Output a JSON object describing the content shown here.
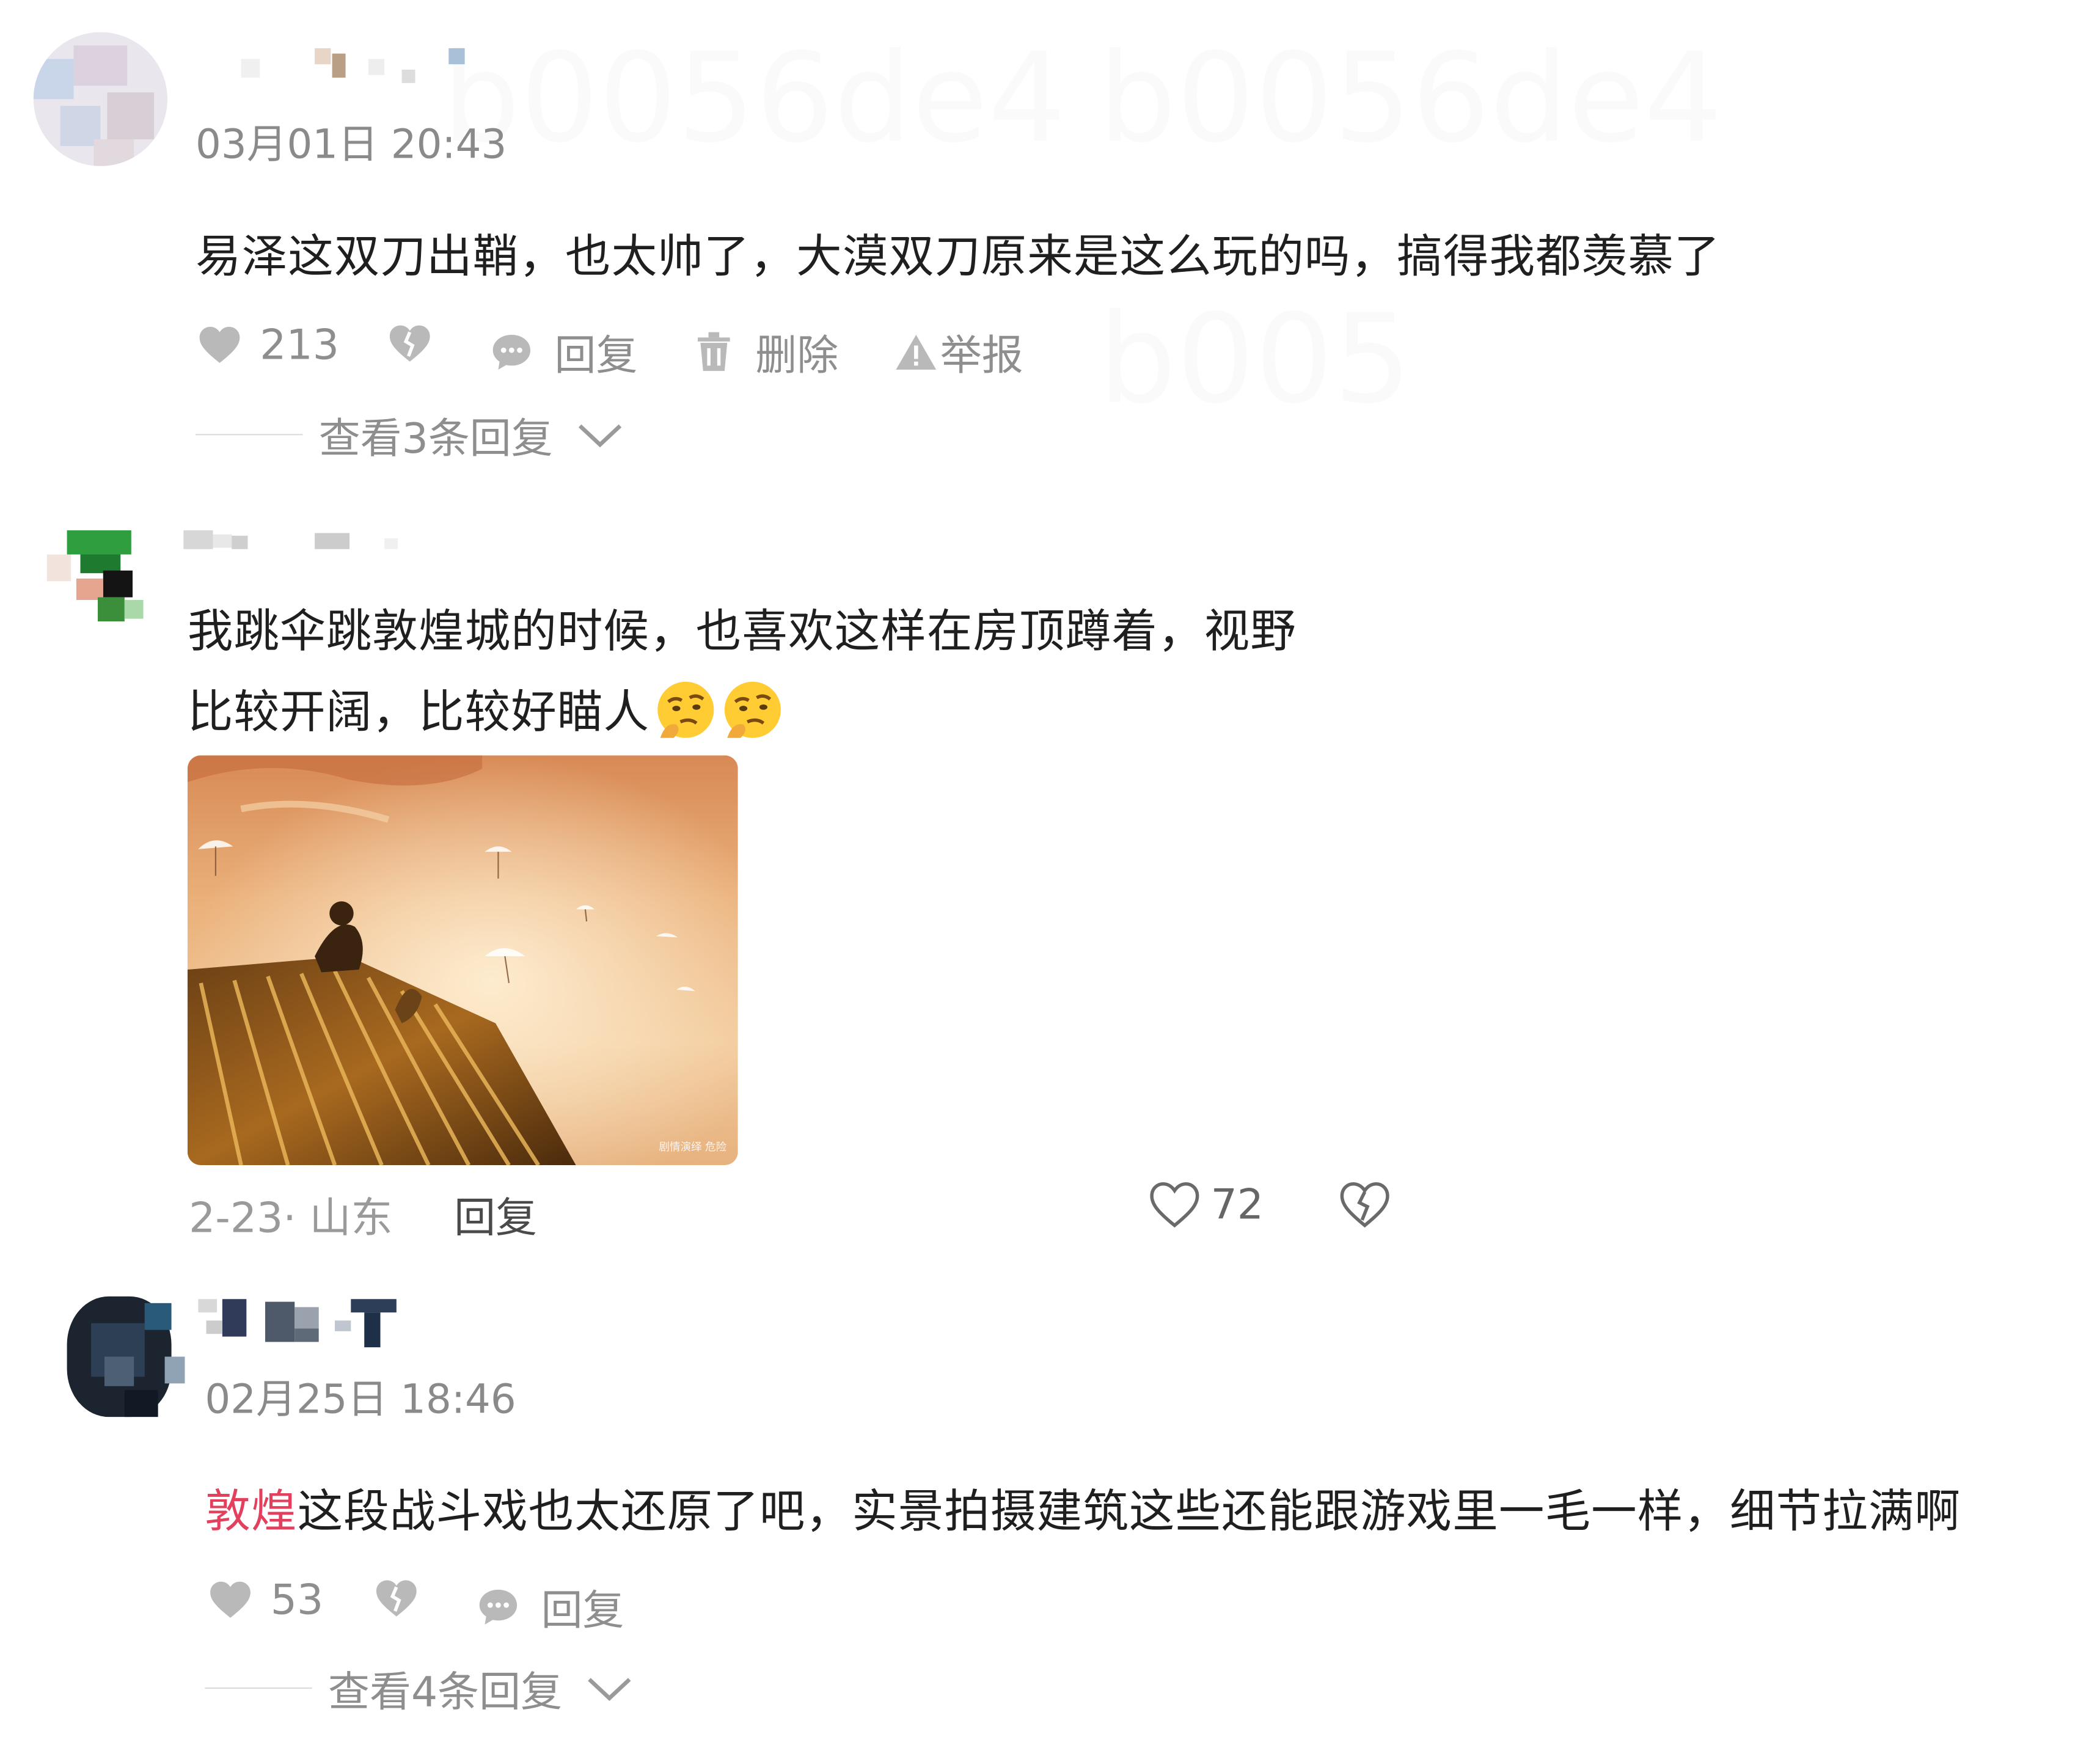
{
  "watermark": {
    "text_1": "b0056de4",
    "text_2": "b0056de4",
    "text_3": "b005"
  },
  "comment_1": {
    "timestamp": "03月01日 20:43",
    "text": "易泽这双刀出鞘，也太帅了，大漠双刀原来是这么玩的吗，搞得我都羡慕了",
    "likes": "213",
    "reply_label": "回复",
    "delete_label": "删除",
    "report_label": "举报",
    "view_replies": "查看3条回复"
  },
  "comment_2": {
    "text_line_1": "我跳伞跳敦煌城的时候，也喜欢这样在房顶蹲着，视野",
    "text_line_2": "比较开阔，比较好瞄人",
    "meta": "2-23· 山东",
    "reply_label": "回复",
    "likes": "72",
    "image_caption": "剧情演绎 危险"
  },
  "comment_3": {
    "timestamp": "02月25日 18:46",
    "highlight": "敦煌",
    "text": "这段战斗戏也太还原了吧，实景拍摄建筑这些还能跟游戏里一毛一样，细节拉满啊",
    "likes": "53",
    "reply_label": "回复",
    "view_replies": "查看4条回复"
  },
  "colors": {
    "highlight": "#e2405c",
    "muted": "#8e8e8e",
    "text": "#1f1f1f"
  }
}
